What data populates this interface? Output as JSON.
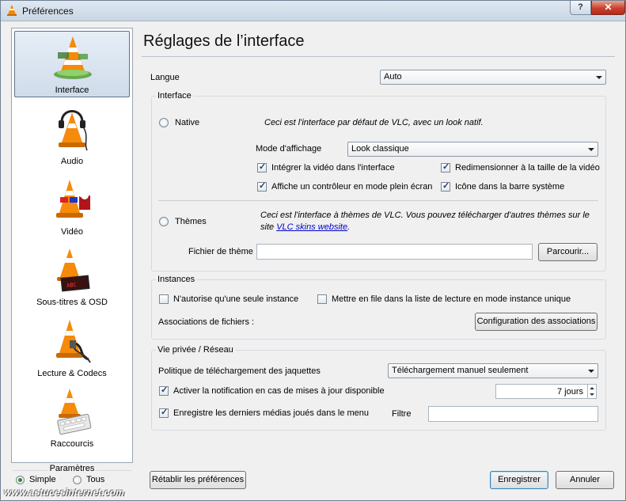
{
  "window": {
    "title": "Préférences",
    "help_label": "?",
    "close_label": "✕"
  },
  "sidebar": {
    "items": [
      {
        "label": "Interface",
        "icon": "vlc-cone-interface-icon",
        "selected": true
      },
      {
        "label": "Audio",
        "icon": "vlc-cone-headphones-icon",
        "selected": false
      },
      {
        "label": "Vidéo",
        "icon": "vlc-cone-glasses-icon",
        "selected": false
      },
      {
        "label": "Sous-titres & OSD",
        "icon": "vlc-cone-subtitle-icon",
        "selected": false
      },
      {
        "label": "Lecture & Codecs",
        "icon": "vlc-cone-cable-icon",
        "selected": false
      },
      {
        "label": "Raccourcis",
        "icon": "vlc-cone-keyboard-icon",
        "selected": false
      }
    ]
  },
  "params": {
    "title": "Paramètres",
    "simple": "Simple",
    "all": "Tous",
    "selected": "Simple"
  },
  "main": {
    "title": "Réglages de l’interface",
    "langue_label": "Langue",
    "langue_value": "Auto",
    "interface_group": {
      "title": "Interface",
      "native_label": "Native",
      "native_desc": "Ceci est l'interface par défaut de VLC, avec un look natif.",
      "mode_label": "Mode d'affichage",
      "mode_value": "Look classique",
      "checks": [
        {
          "label": "Intégrer la vidéo dans l'interface",
          "checked": true
        },
        {
          "label": "Redimensionner à la taille de la vidéo",
          "checked": true
        },
        {
          "label": "Affiche un contrôleur en mode plein écran",
          "checked": true
        },
        {
          "label": "Icône dans la barre système",
          "checked": true
        }
      ],
      "themes_label": "Thèmes",
      "themes_desc_1": "Ceci est l'interface à thèmes de VLC. Vous pouvez télécharger d'autres thèmes sur le",
      "themes_desc_2_prefix": "site ",
      "themes_desc_link": "VLC skins website",
      "themes_desc_2_suffix": ".",
      "theme_file_label": "Fichier de thème",
      "theme_file_value": "",
      "browse_label": "Parcourir..."
    },
    "instances_group": {
      "title": "Instances",
      "single_instance": {
        "label": "N'autorise qu'une seule instance",
        "checked": false
      },
      "enqueue": {
        "label": "Mettre en file dans la liste de lecture en mode instance unique",
        "checked": false
      },
      "assoc_label": "Associations de fichiers :",
      "assoc_button": "Configuration des associations"
    },
    "privacy_group": {
      "title": "Vie privée / Réseau",
      "art_label": "Politique de téléchargement des jaquettes",
      "art_value": "Téléchargement manuel seulement",
      "update": {
        "label": "Activer la notification en cas de mises à jour disponible",
        "checked": true
      },
      "update_days": "7 jours",
      "recent": {
        "label": "Enregistre les derniers médias joués dans le menu",
        "checked": true
      },
      "filter_label": "Filtre",
      "filter_value": ""
    }
  },
  "footer": {
    "reset": "Rétablir les préférences",
    "save": "Enregistrer",
    "cancel": "Annuler"
  },
  "watermark": "www.astucesinternet.com"
}
